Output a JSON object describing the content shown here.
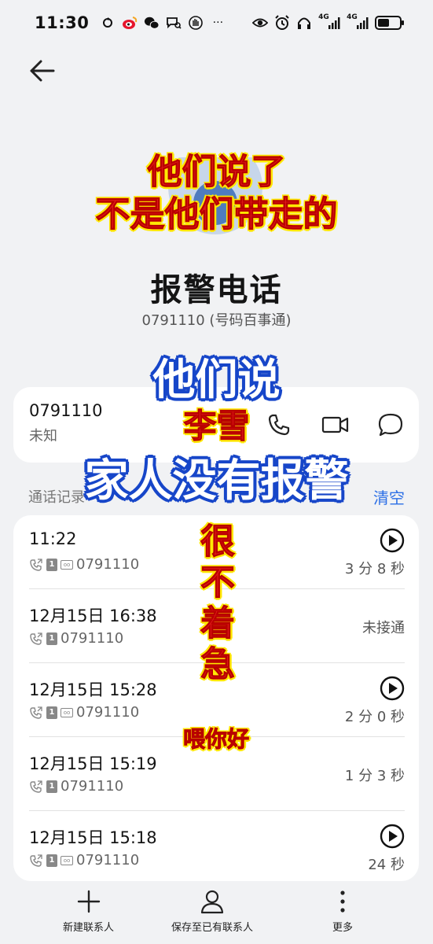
{
  "status_bar": {
    "time": "11:30",
    "left_icons": [
      "sync-icon",
      "weibo-icon",
      "wechat-icon",
      "chat-search-icon",
      "hand-icon",
      "more-dots-icon"
    ],
    "more": "···",
    "net1": "4G",
    "net2": "4G",
    "battery_level": 0.55
  },
  "contact": {
    "name": "报警电话",
    "subtitle": "0791110 (号码百事通)"
  },
  "number_card": {
    "number": "0791110",
    "location": "未知"
  },
  "history": {
    "title": "通话记录",
    "clear_label": "清空",
    "rows": [
      {
        "time": "11:22",
        "number": "0791110",
        "status": "3 分 8 秒",
        "has_recording": true
      },
      {
        "time": "12月15日 16:38",
        "number": "0791110",
        "status": "未接通",
        "has_recording": false
      },
      {
        "time": "12月15日 15:28",
        "number": "0791110",
        "status": "2 分 0 秒",
        "has_recording": true
      },
      {
        "time": "12月15日 15:19",
        "number": "0791110",
        "status": "1 分 3 秒",
        "has_recording": false
      },
      {
        "time": "12月15日 15:18",
        "number": "0791110",
        "status": "24 秒",
        "has_recording": true
      }
    ],
    "sim_label": "1"
  },
  "bottom_bar": {
    "new_contact": "新建联系人",
    "save_existing": "保存至已有联系人",
    "more": "更多"
  },
  "captions": {
    "line1": "他们说了",
    "line2": "不是他们带走的",
    "line3": "他们说",
    "line4": "李雪",
    "line5": "家人没有报警",
    "line6a": "很",
    "line6b": "不",
    "line6c": "着",
    "line6d": "急",
    "line7": "喂你好"
  },
  "colors": {
    "accent": "#2c6fe6",
    "caption_red": "#e21a1a",
    "caption_yellow": "#ffe800",
    "caption_blue": "#1746c9"
  }
}
